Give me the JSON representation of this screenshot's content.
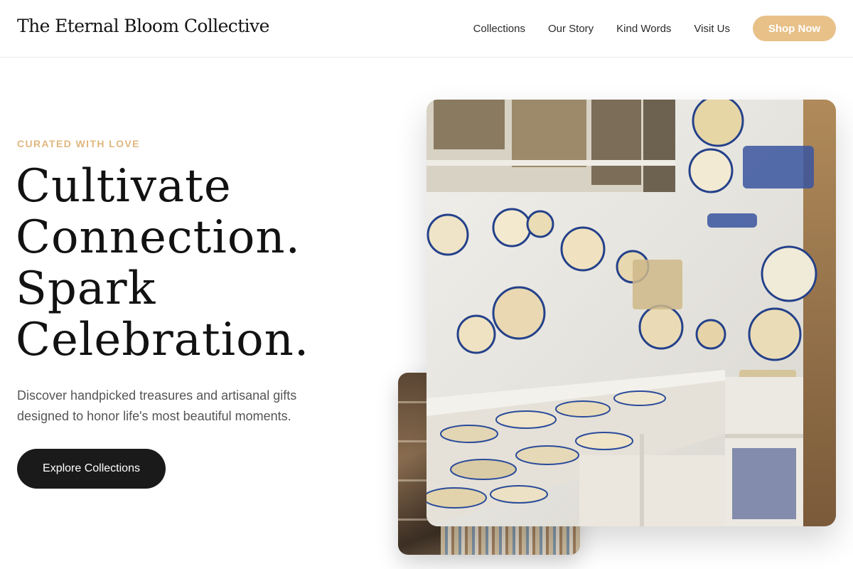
{
  "header": {
    "brand": "The Eternal Bloom Collective",
    "nav": [
      "Collections",
      "Our Story",
      "Kind Words",
      "Visit Us"
    ],
    "cta": "Shop Now"
  },
  "hero": {
    "eyebrow": "CURATED WITH LOVE",
    "headline": [
      "Cultivate",
      "Connection.",
      "Spark",
      "Celebration."
    ],
    "subtext": "Discover handpicked treasures and artisanal gifts designed to honor life's most beautiful moments.",
    "button": "Explore Collections"
  },
  "images": {
    "main": "ceramics-shop-photo",
    "secondary": "gift-shop-interior-photo"
  },
  "colors": {
    "accent": "#e8c189",
    "eyebrow": "#e0b77f",
    "dark_button": "#1a1a1a"
  }
}
